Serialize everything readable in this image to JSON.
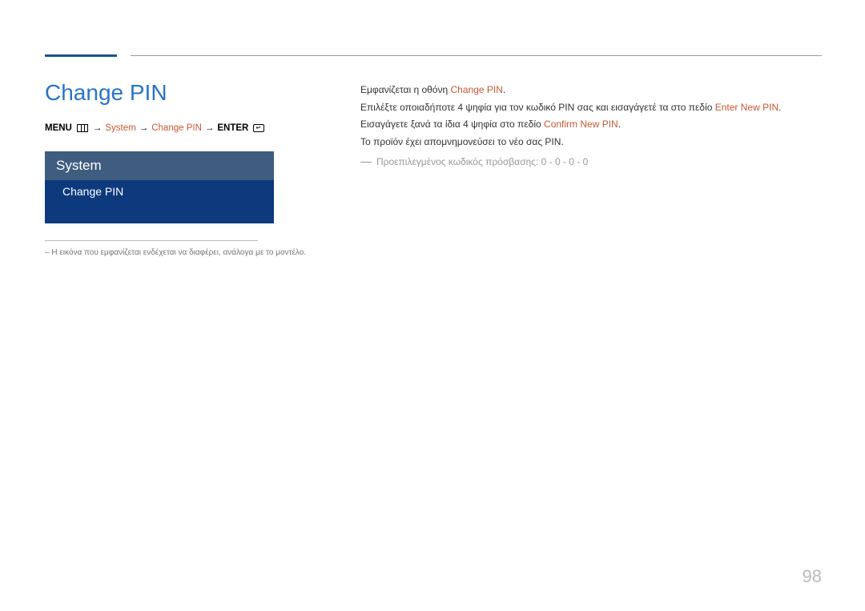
{
  "title": "Change PIN",
  "breadcrumb": {
    "menu_label": "MENU",
    "arrow": "→",
    "item1": "System",
    "item2": "Change PIN",
    "enter_label": "ENTER"
  },
  "menu": {
    "header": "System",
    "selected": "Change PIN"
  },
  "footnote": "– Η εικόνα που εμφανίζεται ενδέχεται να διαφέρει, ανάλογα με το μοντέλο.",
  "content": {
    "line1_a": "Εμφανίζεται η οθόνη ",
    "line1_b": "Change PIN",
    "line1_c": ".",
    "line2_a": "Επιλέξτε οποιαδήποτε 4 ψηφία για τον κωδικό PIN σας και εισαγάγετέ τα στο πεδίο ",
    "line2_b": "Enter New PIN",
    "line2_c": ". Εισαγάγετε ξανά τα ίδια 4 ψηφία στο πεδίο ",
    "line2_d": "Confirm New PIN",
    "line2_e": ".",
    "line3": "Το προϊόν έχει απομνημονεύσει το νέο σας PIN.",
    "note": "Προεπιλεγμένος κωδικός πρόσβασης: 0 - 0 - 0 - 0"
  },
  "page_number": "98"
}
